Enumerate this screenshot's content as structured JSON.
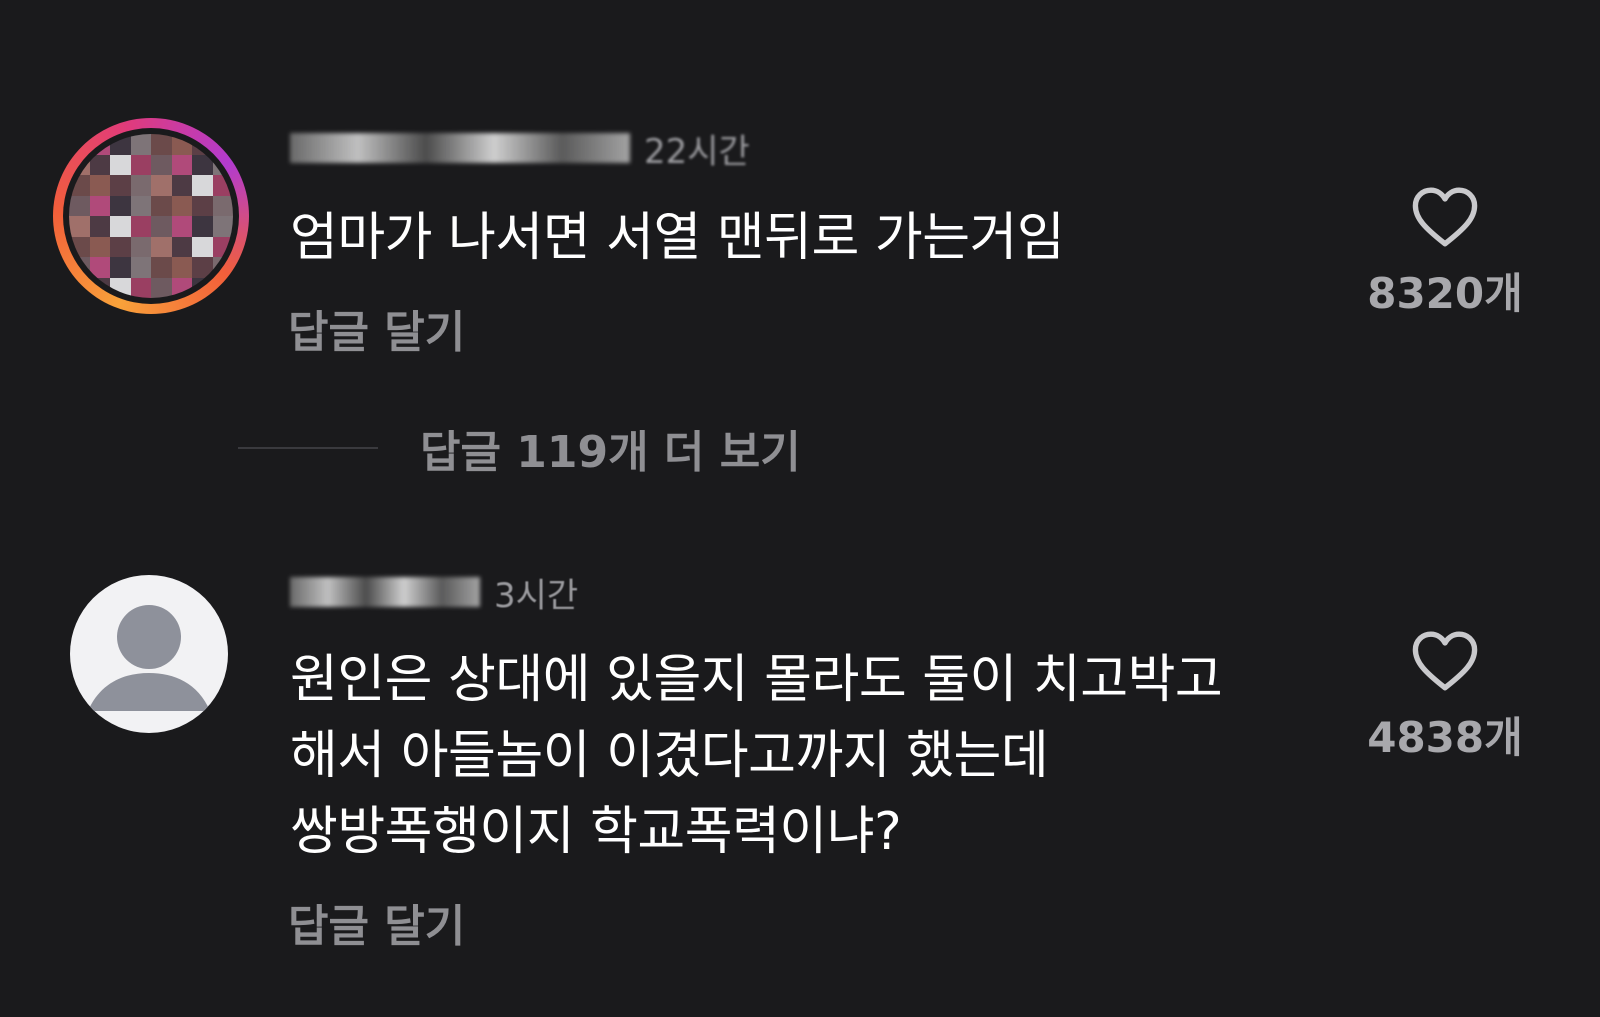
{
  "comments": [
    {
      "time": "22시간",
      "text": "엄마가 나서면 서열 맨뒤로 가는거임",
      "reply_label": "답글 달기",
      "like_count": "8320개",
      "avatar_icon": "pixelated-profile-photo"
    },
    {
      "time": "3시간",
      "text": "원인은 상대에 있을지 몰라도 둘이 치고박고\n해서 아들놈이 이겼다고까지 했는데\n쌍방폭행이지 학교폭력이냐?",
      "reply_label": "답글 달기",
      "like_count": "4838개",
      "avatar_icon": "default-user-icon"
    }
  ],
  "more_replies": {
    "label": "답글 119개 더 보기"
  },
  "colors": {
    "background": "#1a1a1c",
    "text_primary": "#ffffff",
    "text_secondary": "#8f8f93",
    "story_ring": "#e13b7a"
  },
  "icons": {
    "like": "heart-outline-icon"
  }
}
